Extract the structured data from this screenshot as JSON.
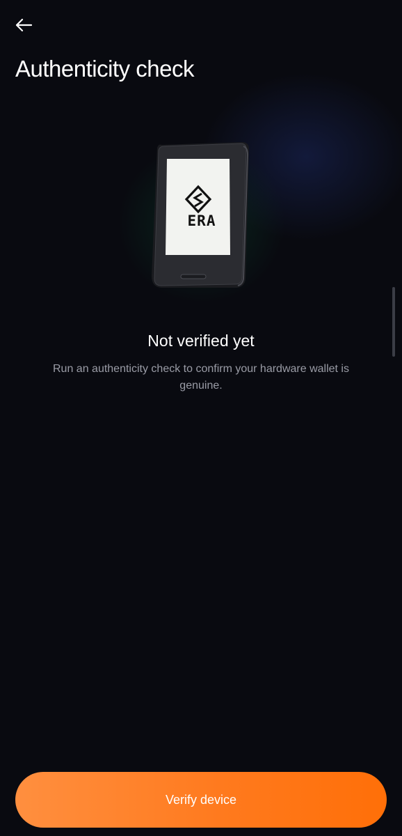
{
  "header": {
    "back_icon": "arrow-left-icon",
    "title": "Authenticity check"
  },
  "device": {
    "brand": "ERA",
    "logo_icon": "era-logo-icon",
    "glow_color": "#14a05a"
  },
  "status": {
    "title": "Not verified yet",
    "description": "Run an authenticity check to confirm your hardware wallet is genuine."
  },
  "actions": {
    "verify_label": "Verify device",
    "verify_color": "#ff7a1e"
  }
}
